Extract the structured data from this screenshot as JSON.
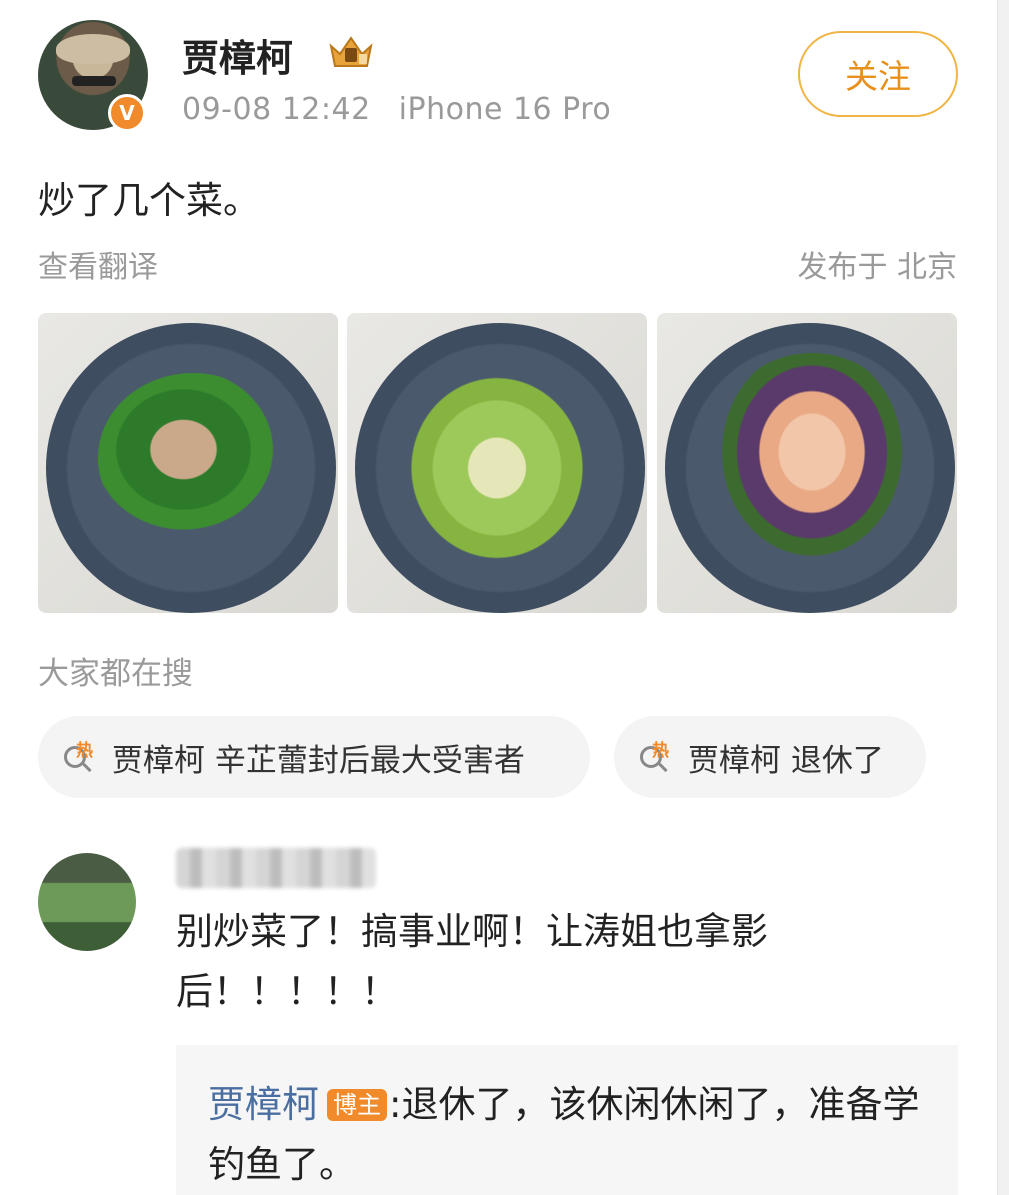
{
  "post": {
    "username": "贾樟柯",
    "time": "09-08 12:42",
    "device": "iPhone 16 Pro",
    "follow_label": "关注",
    "content": "炒了几个菜。",
    "translate_label": "查看翻译",
    "location": "发布于 北京",
    "verified_mark": "V"
  },
  "hot_search": {
    "title": "大家都在搜",
    "tag": "热",
    "items": [
      "贾樟柯 辛芷蕾封后最大受害者",
      "贾樟柯 退休了"
    ]
  },
  "comment": {
    "text": "别炒菜了！搞事业啊！让涛姐也拿影后！！！！！",
    "reply": {
      "name": "贾樟柯",
      "badge": "博主",
      "text": ":退休了，该休闲休闲了，准备学钓鱼了。"
    }
  },
  "colors": {
    "accent": "#f08a2a",
    "follow_border": "#f0b544",
    "link_name": "#4a6ea0"
  },
  "icons": [
    "crown-badge-icon",
    "verified-icon",
    "hot-search-icon"
  ]
}
